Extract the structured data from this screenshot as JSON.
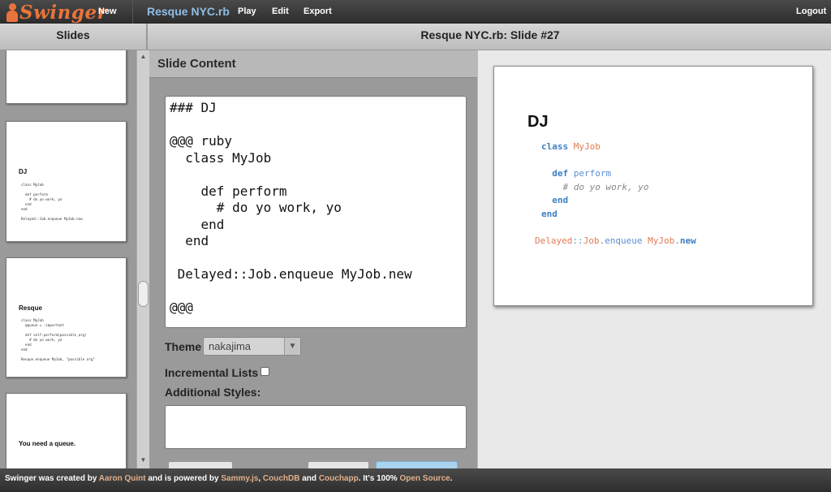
{
  "app": {
    "logo_text": "Swinger",
    "project_title": "Resque NYC.rb",
    "nav": {
      "new": "New",
      "play": "Play",
      "edit": "Edit",
      "export": "Export",
      "logout": "Logout"
    },
    "brand_color": "#e8743b"
  },
  "headers": {
    "slides": "Slides",
    "slide": "Resque NYC.rb: Slide #27"
  },
  "sidebar": {
    "thumbs": [
      {
        "title": "",
        "code": ""
      },
      {
        "title": "DJ",
        "code": "class MyJob\n\n  def perform\n    # do yo work, yo\n  end\nend\n\nDelayed::Job.enqueue MyJob.new"
      },
      {
        "title": "Resque",
        "code": "class MyJob\n  @queue = :important\n\n  def self.perform(possible_arg)\n    # do yo work, yo\n  end\nend\n\nResque.enqueue MyJob, \"possible arg\""
      },
      {
        "title": "You need a queue.",
        "code": ""
      }
    ]
  },
  "editor": {
    "header": "Slide Content",
    "content": "### DJ\n\n@@@ ruby\n  class MyJob\n\n    def perform\n      # do yo work, yo\n    end\n  end\n\n Delayed::Job.enqueue MyJob.new\n\n@@@",
    "theme_label": "Theme",
    "theme_value": "nakajima",
    "incremental_label": "Incremental Lists",
    "additional_styles_label": "Additional Styles:"
  },
  "preview": {
    "title": "DJ",
    "code_tokens": {
      "kw_class": "class",
      "cls_myjob": "MyJob",
      "kw_def": "def",
      "mth_perform": "perform",
      "cmt": "# do yo work, yo",
      "kw_end": "end",
      "ns_delayed": "Delayed",
      "sep": "::",
      "cls_job": "Job",
      "dot": ".",
      "mth_enqueue": "enqueue",
      "cls_myjob2": "MyJob",
      "kw_new": "new"
    }
  },
  "footer": {
    "t1": "Swinger was created by ",
    "l1": "Aaron Quint",
    "t2": " and is powered by ",
    "l2": "Sammy.js",
    "t3": ", ",
    "l3": "CouchDB",
    "t4": " and ",
    "l4": "Couchapp",
    "t5": ". It's 100% ",
    "l5": "Open Source",
    "t6": "."
  }
}
